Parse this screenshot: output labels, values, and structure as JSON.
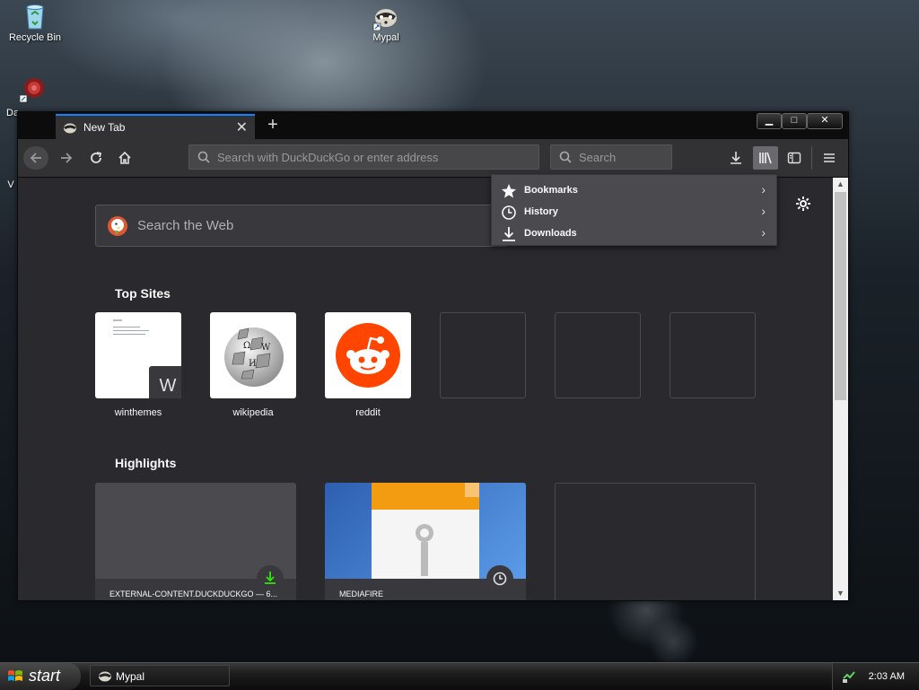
{
  "desktop": {
    "icons": [
      {
        "label": "Recycle Bin"
      },
      {
        "label": "Mypal"
      },
      {
        "label": "Da"
      },
      {
        "label": "V"
      }
    ]
  },
  "browser": {
    "tab_title": "New Tab",
    "url_placeholder": "Search with DuckDuckGo or enter address",
    "search_placeholder": "Search",
    "web_search_placeholder": "Search the Web",
    "top_sites_title": "Top Sites",
    "top_sites": [
      {
        "label": "winthemes"
      },
      {
        "label": "wikipedia"
      },
      {
        "label": "reddit"
      }
    ],
    "winthemes_letter": "W",
    "highlights_title": "Highlights",
    "highlights": [
      {
        "label": "EXTERNAL-CONTENT.DUCKDUCKGO — 6..."
      },
      {
        "label": "MEDIAFIRE"
      }
    ]
  },
  "library_menu": {
    "items": [
      {
        "label": "Bookmarks",
        "icon": "star-icon"
      },
      {
        "label": "History",
        "icon": "clock-icon"
      },
      {
        "label": "Downloads",
        "icon": "download-icon"
      }
    ]
  },
  "taskbar": {
    "start_label": "start",
    "task_label": "Mypal",
    "clock": "2:03 AM"
  },
  "colors": {
    "accent": "#0a84ff",
    "reddit": "#ff4500",
    "toolbar": "#323234",
    "content_bg": "#2a2a2e"
  }
}
